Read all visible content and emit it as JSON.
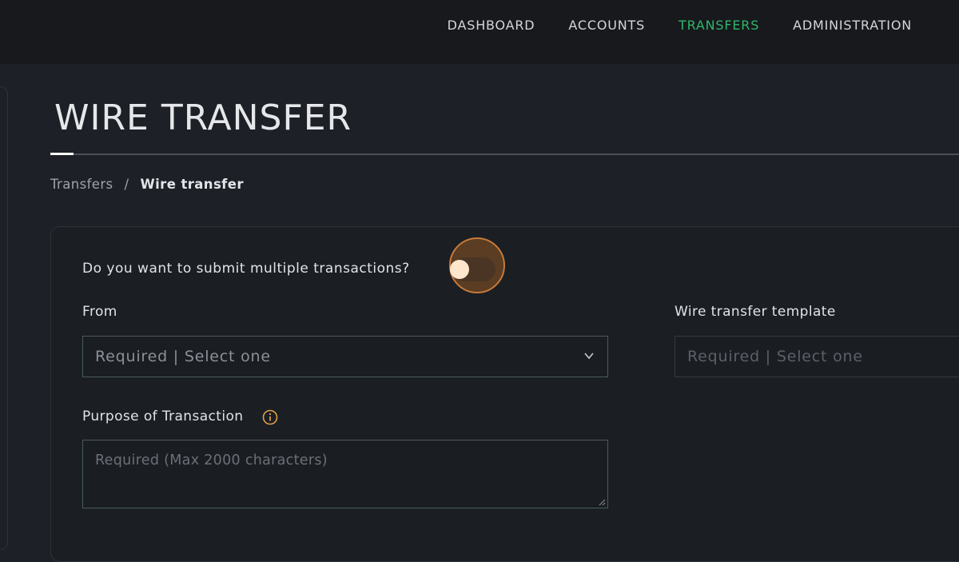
{
  "nav": {
    "items": [
      {
        "label": "DASHBOARD",
        "active": false
      },
      {
        "label": "ACCOUNTS",
        "active": false
      },
      {
        "label": "TRANSFERS",
        "active": true
      },
      {
        "label": "ADMINISTRATION",
        "active": false
      }
    ],
    "active_color": "#2fb66a"
  },
  "page": {
    "title": "WIRE TRANSFER"
  },
  "breadcrumb": {
    "parent": "Transfers",
    "separator": "/",
    "current": "Wire transfer"
  },
  "form": {
    "multiple_question": "Do you want to submit multiple transactions?",
    "multiple_toggle_on": false,
    "from": {
      "label": "From",
      "placeholder": "Required | Select one"
    },
    "template": {
      "label": "Wire transfer template",
      "placeholder": "Required | Select one"
    },
    "purpose": {
      "label": "Purpose of Transaction",
      "placeholder": "Required (Max 2000 characters)"
    }
  },
  "icons": {
    "chevron": "chevron-down-icon",
    "info": "info-icon",
    "accent": "#e0a04a"
  }
}
